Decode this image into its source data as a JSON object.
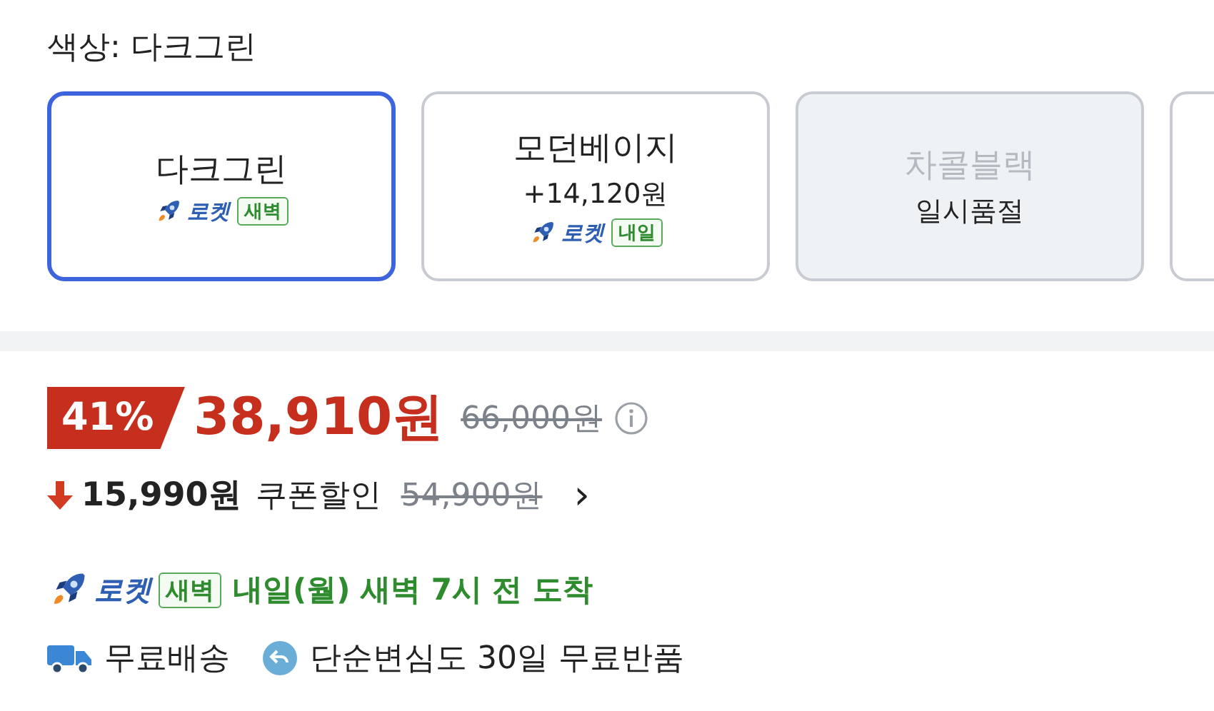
{
  "option_label": "색상: 다크그린",
  "options": [
    {
      "name": "다크그린",
      "selected": true,
      "sold_out": false,
      "delivery": {
        "brand": "로켓",
        "tag": "새벽"
      }
    },
    {
      "name": "모던베이지",
      "price": "+14,120원",
      "selected": false,
      "sold_out": false,
      "delivery": {
        "brand": "로켓",
        "tag": "내일"
      }
    },
    {
      "name": "차콜블랙",
      "status": "일시품절",
      "selected": false,
      "sold_out": true
    }
  ],
  "price": {
    "discount": "41%",
    "sale_price": "38,910원",
    "original_price": "66,000원"
  },
  "coupon": {
    "amount": "15,990원",
    "label": "쿠폰할인",
    "price_before": "54,900원",
    "chevron": "›"
  },
  "shipping": {
    "brand": "로켓",
    "tag": "새벽",
    "arrival": "내일(월) 새벽 7시 전 도착"
  },
  "benefits": [
    {
      "kind": "truck",
      "text": "무료배송"
    },
    {
      "kind": "return",
      "text": "단순변심도 30일 무료반품"
    }
  ]
}
